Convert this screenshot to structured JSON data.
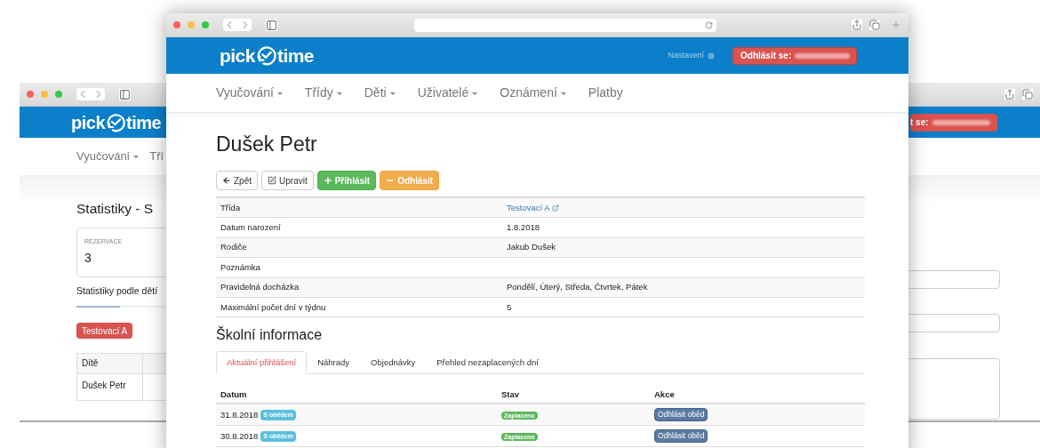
{
  "back_window": {
    "logo": {
      "left": "pick",
      "right": "time"
    },
    "logout_label": "t se:",
    "nav": [
      {
        "label": "Vyučování",
        "caret": true
      },
      {
        "label": "Tří",
        "caret": false
      }
    ],
    "title": "Statistiky - S",
    "stat_card": {
      "label": "REZERVACE",
      "value": "3"
    },
    "subtitle": "Statistiky podle dětí",
    "class_button": "Testovací A",
    "table": {
      "columns": [
        "Dítě"
      ],
      "rows": [
        [
          "Dušek Petr"
        ]
      ]
    }
  },
  "front_window": {
    "logo": {
      "left": "pick",
      "right": "time"
    },
    "settings": "Nastavení",
    "logout_label": "Odhlásit se:",
    "nav": [
      {
        "label": "Vyučování",
        "caret": true
      },
      {
        "label": "Třídy",
        "caret": true
      },
      {
        "label": "Děti",
        "caret": true
      },
      {
        "label": "Uživatelé",
        "caret": true
      },
      {
        "label": "Oznámení",
        "caret": true
      },
      {
        "label": "Platby",
        "caret": false
      }
    ],
    "title": "Dušek Petr",
    "actions": [
      {
        "label": "Zpět",
        "kind": "back"
      },
      {
        "label": "Upravit",
        "kind": "edit"
      },
      {
        "label": "Přihlásit",
        "kind": "add"
      },
      {
        "label": "Odhlásit",
        "kind": "remove"
      }
    ],
    "details": [
      {
        "label": "Třída",
        "value": "Testovací A",
        "kind": "link"
      },
      {
        "label": "Datum narození",
        "value": "1.8.2018",
        "kind": "text"
      },
      {
        "label": "Rodiče",
        "value": "Jakub Dušek",
        "kind": "text"
      },
      {
        "label": "Poznámka",
        "kind": "text"
      },
      {
        "label": "Pravidelná docházka",
        "value": "Pondělí, Úterý, Středa, Čtvrtek, Pátek",
        "kind": "text"
      },
      {
        "label": "Maximální počet dní v týdnu",
        "value": "5",
        "kind": "text"
      }
    ],
    "section_title": "Školní informace",
    "tabs": [
      {
        "label": "Aktuální přihlášení",
        "selected": true
      },
      {
        "label": "Náhrady",
        "selected": false
      },
      {
        "label": "Objednávky",
        "selected": false
      },
      {
        "label": "Přehled nezaplacených dní",
        "selected": false
      }
    ],
    "table": {
      "columns": [
        "Datum",
        "Stav",
        "Akce"
      ],
      "rows": [
        {
          "date": "31.8.2018",
          "tag": "S obědem",
          "status": "Zaplaceno",
          "action": "Odhlásit oběd"
        },
        {
          "date": "30.8.2018",
          "tag": "S obědem",
          "status": "Zaplaceno",
          "action": "Odhlásit oběd"
        }
      ]
    }
  }
}
